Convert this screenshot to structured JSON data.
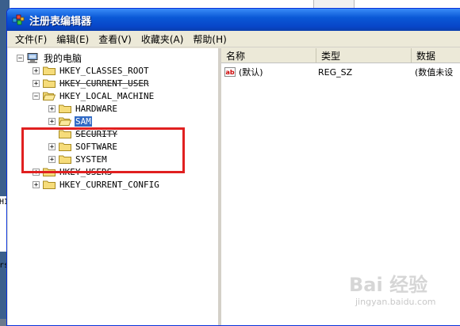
{
  "window": {
    "title": "注册表编辑器"
  },
  "menu": [
    {
      "label": "文件(F)"
    },
    {
      "label": "编辑(E)"
    },
    {
      "label": "查看(V)"
    },
    {
      "label": "收藏夹(A)"
    },
    {
      "label": "帮助(H)"
    }
  ],
  "tree": {
    "root": "我的电脑",
    "classes_root": "HKEY_CLASSES_ROOT",
    "current_user": "HKEY_CURRENT_USER",
    "local_machine": "HKEY_LOCAL_MACHINE",
    "hardware": "HARDWARE",
    "sam": "SAM",
    "security": "SECURITY",
    "software": "SOFTWARE",
    "system": "SYSTEM",
    "users": "HKEY_USERS",
    "current_config": "HKEY_CURRENT_CONFIG"
  },
  "list": {
    "columns": {
      "name": "名称",
      "type": "类型",
      "data": "数据"
    },
    "rows": [
      {
        "name": "(默认)",
        "type": "REG_SZ",
        "data": "(数值未设"
      }
    ]
  },
  "background": {
    "left_text_1": "HI",
    "left_text_2": "rs"
  },
  "watermark": {
    "main": "Bai 经验",
    "sub": "jingyan.baidu.com"
  }
}
